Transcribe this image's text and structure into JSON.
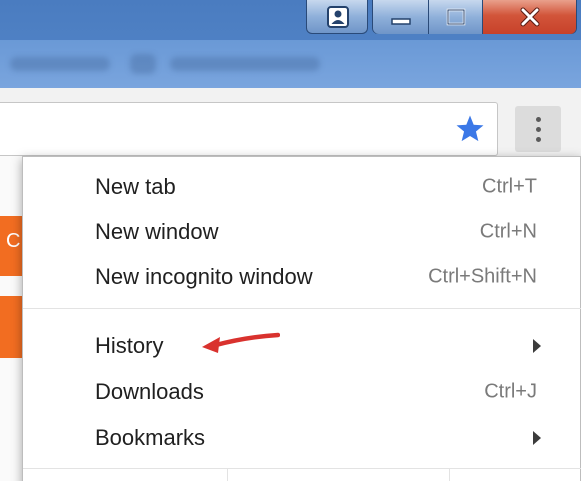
{
  "window": {
    "caption_buttons": {
      "user_icon": "person-icon",
      "minimize_icon": "minimize-icon",
      "maximize_icon": "maximize-icon",
      "close_icon": "close-x-icon"
    }
  },
  "toolbar": {
    "bookmark_icon": "star-icon",
    "bookmark_color": "#3b78e7",
    "menu_icon": "three-dots-vertical-icon"
  },
  "page_peek": {
    "accent_color": "#f26d21",
    "visible_char": "C"
  },
  "menu": {
    "groups": [
      {
        "items": [
          {
            "label": "New tab",
            "shortcut": "Ctrl+T"
          },
          {
            "label": "New window",
            "shortcut": "Ctrl+N"
          },
          {
            "label": "New incognito window",
            "shortcut": "Ctrl+Shift+N"
          }
        ]
      },
      {
        "items": [
          {
            "label": "History",
            "shortcut": "",
            "submenu": true
          },
          {
            "label": "Downloads",
            "shortcut": "Ctrl+J"
          },
          {
            "label": "Bookmarks",
            "shortcut": "",
            "submenu": true
          }
        ]
      }
    ]
  },
  "annotation": {
    "arrow_color": "#d9322e",
    "points_to": "History"
  }
}
